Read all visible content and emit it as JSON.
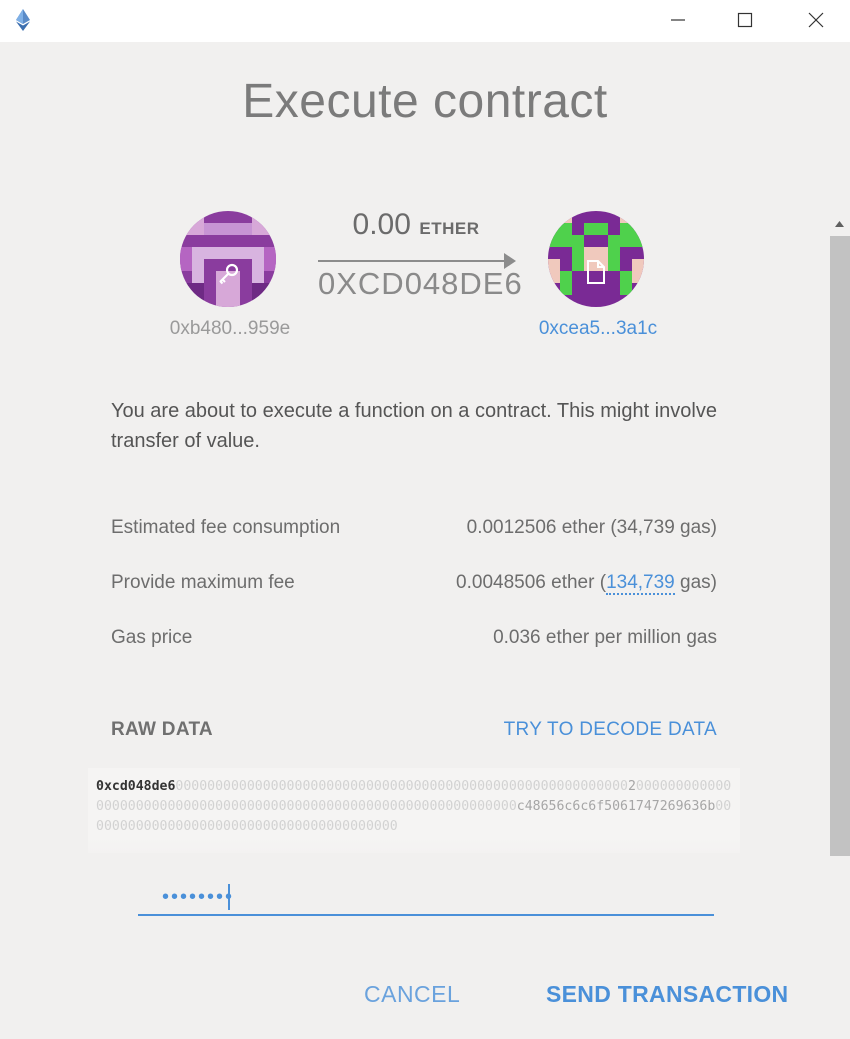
{
  "window": {
    "icons": {
      "app": "ethereum-icon",
      "minimize": "minimize-icon",
      "maximize": "maximize-icon",
      "close": "close-icon"
    }
  },
  "title": "Execute contract",
  "transfer": {
    "from_address": "0xb480...959e",
    "to_address": "0xcea5...3a1c",
    "amount": "0.00",
    "unit": "ETHER",
    "method_id": "0XCD048DE6",
    "from_icon": "key-icon",
    "to_icon": "document-icon",
    "arrow_icon": "arrow-right-icon"
  },
  "description": "You are about to execute a function on a contract. This might involve transfer of value.",
  "fees": {
    "estimated_label": "Estimated fee consumption",
    "estimated_value": "0.0012506 ether (34,739 gas)",
    "max_label": "Provide maximum fee",
    "max_value_prefix": "0.0048506 ether (",
    "max_gas": "134,739",
    "max_value_suffix": " gas)",
    "gas_price_label": "Gas price",
    "gas_price_value": "0.036 ether per million gas"
  },
  "raw_data": {
    "label": "RAW DATA",
    "decode_link": "TRY TO DECODE DATA",
    "selector": "0xcd048de6",
    "segment_1": "000000000000000000000000000000000000000000000000000000000",
    "segment_2": "2",
    "segment_3": "00000000000000000000000000000000000000000000000000000000000000000",
    "hex_string": "c48656c6c6f5061747269636b",
    "segment_4": "0000000000000000000000000000000000000000"
  },
  "password": {
    "value": "••••••••"
  },
  "actions": {
    "cancel": "CANCEL",
    "send": "SEND TRANSACTION"
  },
  "colors": {
    "accent": "#4a90d9",
    "background": "#f1f0ef"
  }
}
